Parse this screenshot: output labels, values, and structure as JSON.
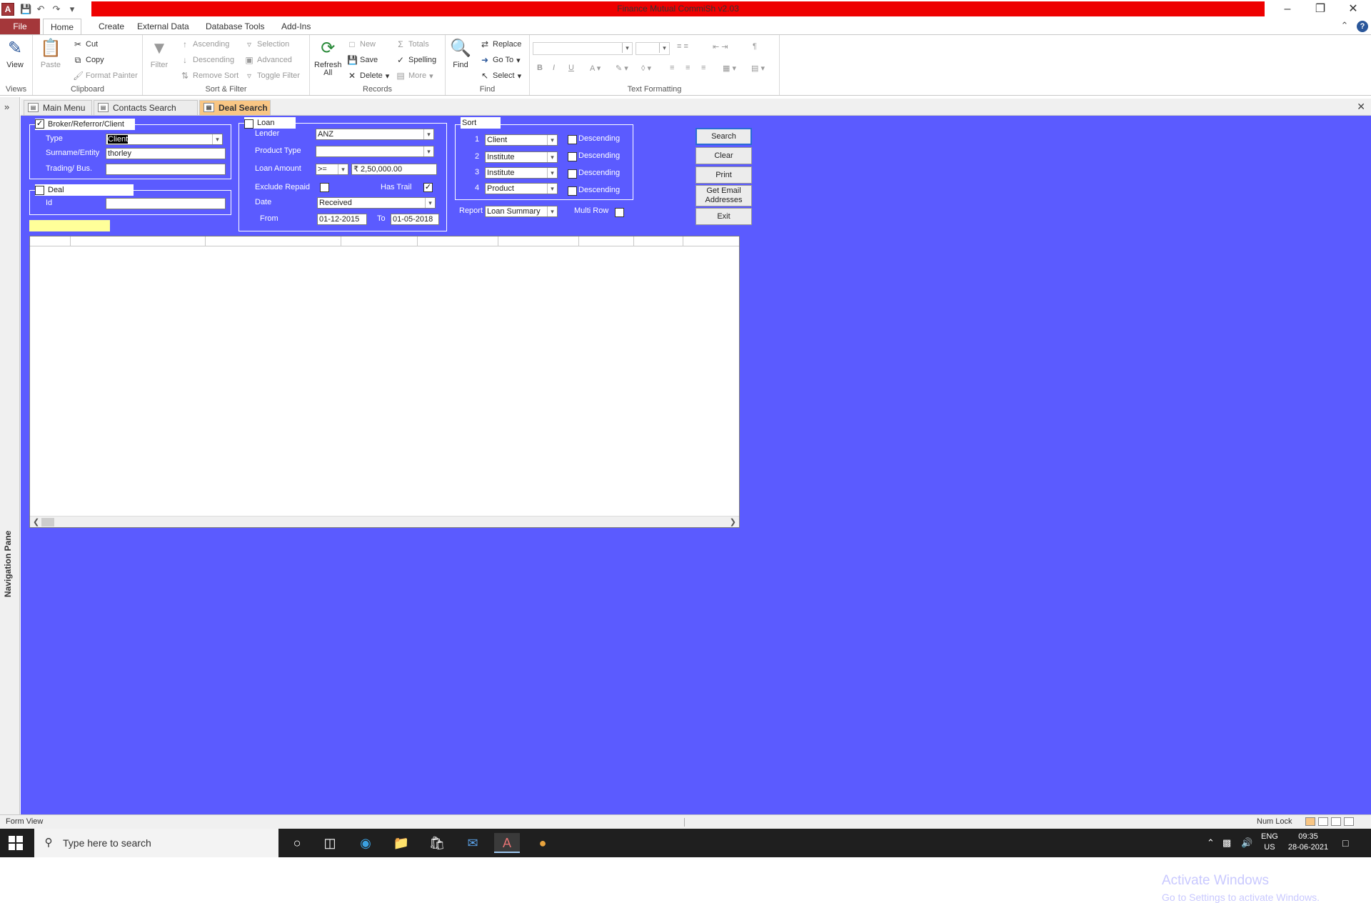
{
  "app": {
    "title": "Finance Mutual CommiSh v2.03"
  },
  "ribbon_tabs": [
    "File",
    "Home",
    "Create",
    "External Data",
    "Database Tools",
    "Add-Ins"
  ],
  "ribbon": {
    "views": {
      "view": "View",
      "label": "Views"
    },
    "clipboard": {
      "paste": "Paste",
      "cut": "Cut",
      "copy": "Copy",
      "format_painter": "Format Painter",
      "label": "Clipboard"
    },
    "sort_filter": {
      "filter": "Filter",
      "ascending": "Ascending",
      "descending": "Descending",
      "remove_sort": "Remove Sort",
      "selection": "Selection",
      "advanced": "Advanced",
      "toggle_filter": "Toggle Filter",
      "label": "Sort & Filter"
    },
    "records": {
      "refresh_all_1": "Refresh",
      "refresh_all_2": "All",
      "new": "New",
      "save": "Save",
      "delete": "Delete",
      "totals": "Totals",
      "spelling": "Spelling",
      "more": "More",
      "label": "Records"
    },
    "find": {
      "find": "Find",
      "replace": "Replace",
      "go_to": "Go To",
      "select": "Select",
      "label": "Find"
    },
    "text_formatting": {
      "label": "Text Formatting"
    }
  },
  "nav_pane": {
    "label": "Navigation Pane"
  },
  "doc_tabs": [
    "Main Menu",
    "Contacts Search",
    "Deal Search"
  ],
  "form": {
    "broker": {
      "legend": "Broker/Referror/Client",
      "checked": true,
      "type_label": "Type",
      "type_value": "Client",
      "surname_label": "Surname/Entity",
      "surname_value": "thorley",
      "trading_label": "Trading/ Bus.",
      "trading_value": ""
    },
    "deal": {
      "legend": "Deal",
      "checked": false,
      "id_label": "Id",
      "id_value": ""
    },
    "loan": {
      "legend": "Loan",
      "checked": false,
      "lender_label": "Lender",
      "lender_value": "ANZ",
      "product_type_label": "Product Type",
      "product_type_value": "",
      "loan_amount_label": "Loan Amount",
      "loan_amount_op": ">=",
      "loan_amount_value": "₹ 2,50,000.00",
      "exclude_repaid_label": "Exclude Repaid",
      "exclude_repaid": false,
      "has_trail_label": "Has Trail",
      "has_trail": true,
      "date_label": "Date",
      "date_value": "Received",
      "from_label": "From",
      "from_value": "01-12-2015",
      "to_label": "To",
      "to_value": "01-05-2018"
    },
    "sort": {
      "legend": "Sort",
      "rows": [
        {
          "n": "1",
          "field": "Client",
          "desc_label": "Descending"
        },
        {
          "n": "2",
          "field": "Institute",
          "desc_label": "Descending"
        },
        {
          "n": "3",
          "field": "Institute",
          "desc_label": "Descending"
        },
        {
          "n": "4",
          "field": "Product",
          "desc_label": "Descending"
        }
      ],
      "report_label": "Report",
      "report_value": "Loan Summary",
      "multi_row_label": "Multi Row"
    },
    "buttons": {
      "search": "Search",
      "clear": "Clear",
      "print": "Print",
      "get_email_1": "Get Email",
      "get_email_2": "Addresses",
      "exit": "Exit"
    }
  },
  "watermark": {
    "line1": "Activate Windows",
    "line2": "Go to Settings to activate Windows."
  },
  "status": {
    "view": "Form View",
    "num_lock": "Num Lock"
  },
  "taskbar": {
    "search_placeholder": "Type here to search",
    "lang1": "ENG",
    "lang2": "US",
    "time": "09:35",
    "date": "28-06-2021"
  }
}
